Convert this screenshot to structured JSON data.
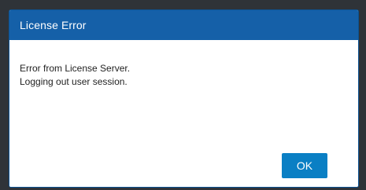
{
  "dialog": {
    "title": "License Error",
    "message_lines": [
      "Error from License Server.",
      "Logging out user session."
    ],
    "ok_label": "OK"
  },
  "colors": {
    "titlebar": "#1560a8",
    "button": "#0a7fc4",
    "backdrop": "#2f3338"
  }
}
